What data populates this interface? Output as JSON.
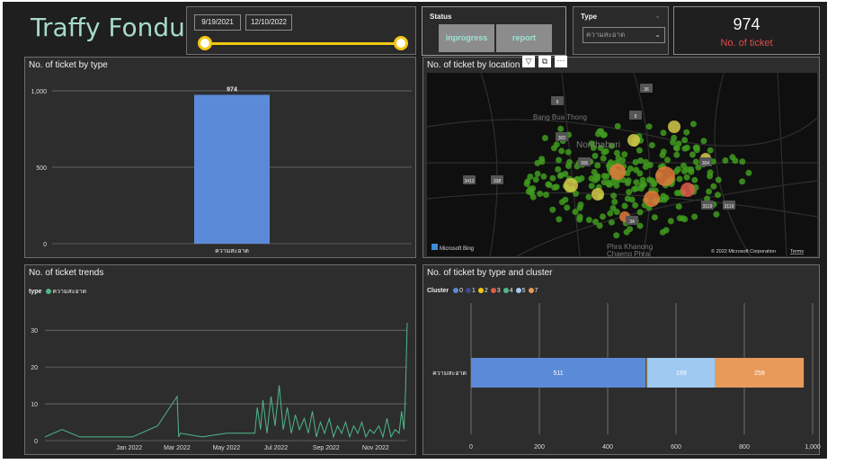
{
  "app": {
    "title": "Traffy Fondue"
  },
  "date_filter": {
    "start": "9/19/2021",
    "end": "12/10/2022"
  },
  "status_slicer": {
    "title": "Status",
    "options": [
      "inprogress",
      "report"
    ]
  },
  "type_slicer": {
    "title": "Type",
    "selected": "ความสะอาด"
  },
  "card": {
    "value": "974",
    "label": "No. of ticket"
  },
  "visual_header": {
    "filter_icon": "filter-icon",
    "focus_icon": "focus-icon",
    "more_label": "···"
  },
  "colors": {
    "accent": "#a6dbc8",
    "bar_blue": "#5b8bd8",
    "line_green": "#4fb889",
    "card_label": "#e04b4b",
    "slider": "#f2c811"
  },
  "chart_type": {
    "title": "No. of ticket by type",
    "chart_data": {
      "type": "bar",
      "categories": [
        "ความสะอาด"
      ],
      "values": [
        974
      ],
      "data_labels": [
        "974"
      ],
      "yticks": [
        "1,000",
        "500",
        "0"
      ],
      "ylim": [
        0,
        1000
      ]
    }
  },
  "chart_map": {
    "title": "No. of ticket by location",
    "place_labels": [
      "Bang Bua Thong",
      "Nonthaburi",
      "Phra Khanong",
      "Chaeng Phrai"
    ],
    "road_badges": [
      "9",
      "36",
      "9",
      "302",
      "306",
      "304",
      "3413",
      "338",
      "34",
      "3119",
      "3119"
    ],
    "attribution": "Microsoft Bing",
    "copyright": "© 2022 Microsoft Corporation",
    "terms": "Terms"
  },
  "chart_trend": {
    "title": "No. of ticket trends",
    "legend_title": "type",
    "legend_item": "ความสะอาด",
    "chart_data": {
      "type": "line",
      "xticks": [
        "Jan 2022",
        "Mar 2022",
        "May 2022",
        "Jul 2022",
        "Sep 2022",
        "Nov 2022"
      ],
      "yticks": [
        "30",
        "20",
        "10",
        "0"
      ],
      "ylim": [
        0,
        32
      ],
      "series": [
        {
          "name": "ความสะอาด",
          "x": [
            "2021-09-19",
            "2021-10-10",
            "2021-11-01",
            "2021-12-01",
            "2022-01-05",
            "2022-02-05",
            "2022-03-01",
            "2022-03-03",
            "2022-03-05",
            "2022-04-01",
            "2022-05-01",
            "2022-06-05",
            "2022-06-08",
            "2022-06-12",
            "2022-06-15",
            "2022-06-20",
            "2022-06-25",
            "2022-06-30",
            "2022-07-05",
            "2022-07-10",
            "2022-07-15",
            "2022-07-20",
            "2022-07-25",
            "2022-07-30",
            "2022-08-05",
            "2022-08-10",
            "2022-08-15",
            "2022-08-20",
            "2022-08-25",
            "2022-08-30",
            "2022-09-05",
            "2022-09-10",
            "2022-09-15",
            "2022-09-20",
            "2022-09-25",
            "2022-09-30",
            "2022-10-05",
            "2022-10-10",
            "2022-10-15",
            "2022-10-20",
            "2022-10-25",
            "2022-10-30",
            "2022-11-05",
            "2022-11-10",
            "2022-11-15",
            "2022-11-20",
            "2022-11-25",
            "2022-11-30",
            "2022-12-03",
            "2022-12-06",
            "2022-12-08",
            "2022-12-10"
          ],
          "y": [
            1,
            3,
            1,
            1,
            1,
            4,
            12,
            1,
            2,
            1,
            2,
            2,
            9,
            3,
            11,
            2,
            12,
            4,
            15,
            3,
            9,
            2,
            7,
            3,
            6,
            2,
            8,
            1,
            5,
            2,
            6,
            1,
            4,
            2,
            5,
            1,
            4,
            2,
            5,
            1,
            3,
            2,
            4,
            1,
            6,
            1,
            3,
            2,
            8,
            3,
            14,
            32
          ]
        }
      ]
    }
  },
  "chart_cluster": {
    "title": "No. of ticket by type and cluster",
    "legend_title": "Cluster",
    "legend": [
      {
        "name": "0",
        "color": "#5b8bd8"
      },
      {
        "name": "1",
        "color": "#3f4a8c"
      },
      {
        "name": "2",
        "color": "#f2c811"
      },
      {
        "name": "3",
        "color": "#e05b4b"
      },
      {
        "name": "4",
        "color": "#4fb889"
      },
      {
        "name": "5",
        "color": "#9fc9f0"
      },
      {
        "name": "7",
        "color": "#e89a5a"
      }
    ],
    "chart_data": {
      "type": "bar",
      "orientation": "horizontal",
      "stacked": true,
      "categories": [
        "ความสะอาด"
      ],
      "series": [
        {
          "name": "0",
          "values": [
            511
          ],
          "color": "#5b8bd8"
        },
        {
          "name": "1",
          "values": [
            2
          ],
          "color": "#3f4a8c"
        },
        {
          "name": "2",
          "values": [
            1
          ],
          "color": "#f2c811"
        },
        {
          "name": "3",
          "values": [
            1
          ],
          "color": "#e05b4b"
        },
        {
          "name": "4",
          "values": [
            1
          ],
          "color": "#4fb889"
        },
        {
          "name": "5",
          "values": [
            199
          ],
          "color": "#9fc9f0"
        },
        {
          "name": "7",
          "values": [
            259
          ],
          "color": "#e89a5a"
        }
      ],
      "data_labels": [
        "511",
        "199",
        "259"
      ],
      "xticks": [
        "0",
        "200",
        "400",
        "600",
        "800",
        "1,000"
      ],
      "xlim": [
        0,
        1000
      ]
    }
  }
}
